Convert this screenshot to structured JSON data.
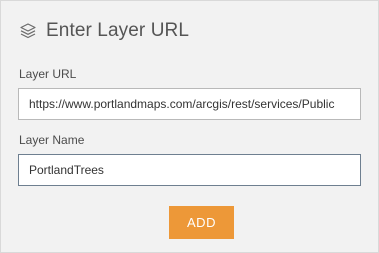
{
  "header": {
    "icon": "layers-icon",
    "title": "Enter Layer URL"
  },
  "layer_url": {
    "label": "Layer URL",
    "value": "https://www.portlandmaps.com/arcgis/rest/services/Public"
  },
  "layer_name": {
    "label": "Layer Name",
    "value": "PortlandTrees"
  },
  "add_button": {
    "label": "ADD",
    "color": "#ed9838"
  }
}
